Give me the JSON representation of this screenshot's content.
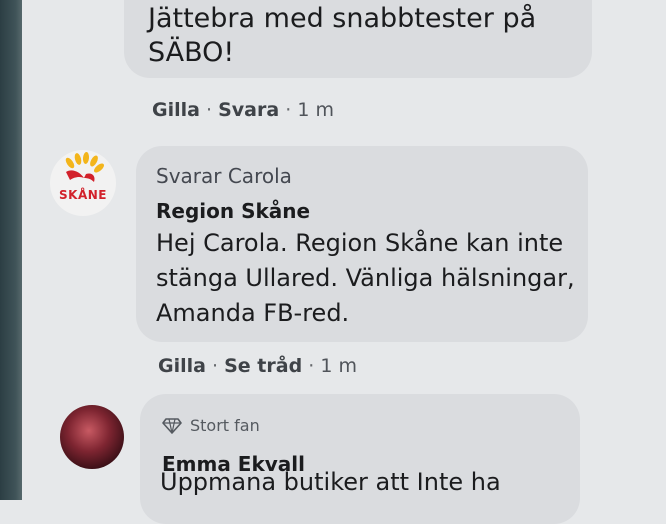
{
  "previous_comment": {
    "text": "Jättebra med snabbtester på SÄBO!",
    "actions": {
      "like": "Gilla",
      "reply": "Svara",
      "time": "1 m"
    }
  },
  "reply": {
    "replying_to": "Svarar Carola",
    "author": "Region Skåne",
    "avatar_icon": "region-skane-logo",
    "avatar_text": "SKÅNE",
    "text": "Hej Carola. Region Skåne kan inte stänga Ullared. Vänliga hälsningar, Amanda FB-red.",
    "actions": {
      "like": "Gilla",
      "thread": "Se tråd",
      "time": "1 m"
    }
  },
  "next_comment": {
    "badge_icon": "diamond-icon",
    "badge": "Stort fan",
    "author": "Emma Ekvall",
    "text": "Uppmana butiker att Inte ha"
  },
  "colors": {
    "bubble": "#dadcdf",
    "background": "#e6e8ea",
    "brand_red": "#d2212b",
    "brand_yellow": "#f3b51b"
  }
}
